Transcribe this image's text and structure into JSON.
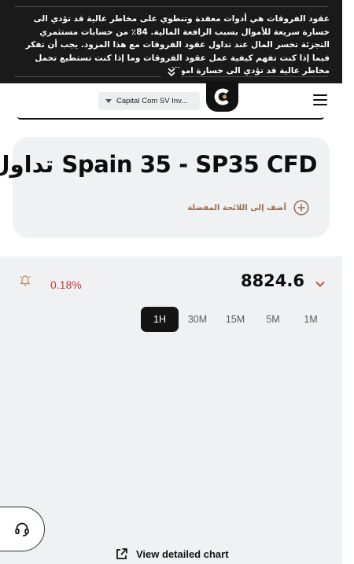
{
  "risk_banner": {
    "text": "عقود الفروقات هي أدوات معقدة وتنطوي على مخاطر عالية قد تؤدي الى خسارة سريعة للأموال بسبب الرافعة المالية. 84٪ من حسابات مستثمري التجزئة تخسر المال عند تداول عقود الفروقات مع هذا المزود. يجب أن تفكر فيما إذا كنت تفهم كيفية عمل عقود الفروقات وما إذا كنت تستطيع تحمل مخاطر عالية قد تؤدي الى خسارة اموالك.",
    "toggle_icon": "double-chevron-down-icon"
  },
  "header": {
    "broker_select": "Capital Com SV Inv...",
    "logo_icon": "capital-com-logo",
    "menu_icon": "hamburger-menu-icon"
  },
  "instrument": {
    "title": "تداول Spain 35 - SP35 CFD",
    "watchlist_label": "أضف إلى اللائحة المفضلة",
    "watchlist_icon": "plus-circle-icon"
  },
  "quote": {
    "price": "8824.6",
    "change": "0.18%",
    "change_color": "#c93a3a",
    "alert_icon": "bell-icon",
    "expand_icon": "chevron-down-icon"
  },
  "timeframes": {
    "items": [
      "1H",
      "30M",
      "15M",
      "5M",
      "1M"
    ],
    "selected": "1H"
  },
  "chart_link": {
    "label": "View detailed chart",
    "icon": "external-link-icon"
  },
  "support": {
    "icon": "headset-icon"
  },
  "colors": {
    "banner_bg": "#1a1a1a",
    "panel_bg": "#eff1f3",
    "accent_negative": "#c93a3a",
    "watchlist_text": "#9a6a4e"
  }
}
